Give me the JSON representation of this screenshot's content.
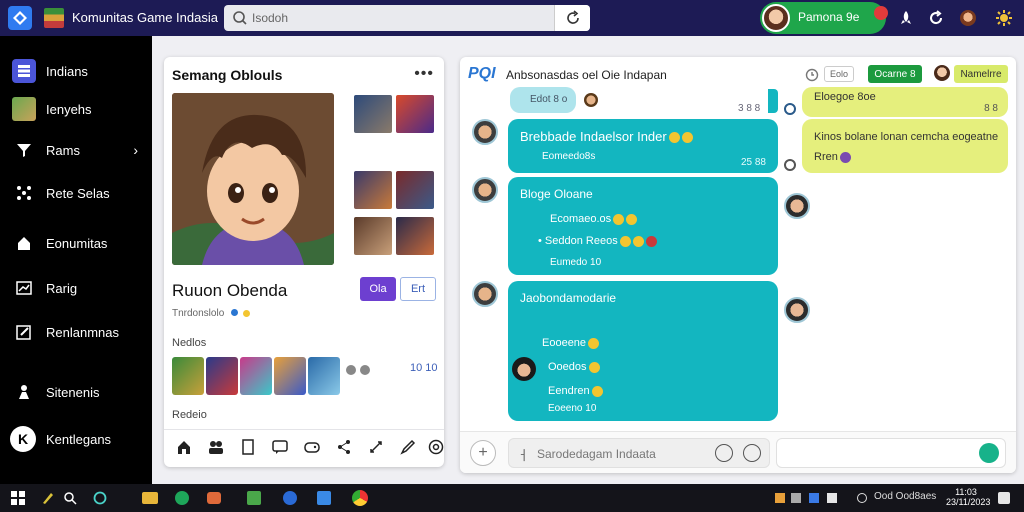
{
  "header": {
    "app_title": "Komunitas Game Indasia",
    "search_placeholder": "Isodoh",
    "user_name": "Pamona 9e",
    "icons": [
      "app-logo-icon",
      "flag-icon",
      "search-icon",
      "refresh-icon",
      "notification-icon",
      "rocket-icon",
      "refresh-circle-icon",
      "avatar-icon",
      "settings-icon"
    ]
  },
  "sidebar": {
    "items": [
      {
        "label": "Indians",
        "icon": "grid-icon"
      },
      {
        "label": "Ienyehs",
        "icon": "image-icon"
      },
      {
        "label": "Rams",
        "icon": "filter-icon",
        "has_chevron": true
      },
      {
        "label": "Rete Selas",
        "icon": "network-icon"
      },
      {
        "label": "Eonumitas",
        "icon": "home-icon"
      },
      {
        "label": "Rarig",
        "icon": "chart-icon"
      },
      {
        "label": "Renlanmnas",
        "icon": "edit-icon"
      },
      {
        "label": "Sitenenis",
        "icon": "person-icon"
      },
      {
        "label": "Kentlegans",
        "icon": "k-badge-icon"
      }
    ],
    "chevron": "›"
  },
  "profile": {
    "title": "Semang Oblouls",
    "more": "•••",
    "name": "Ruuon Obenda",
    "button_primary": "Ola",
    "button_secondary": "Ert",
    "status": "Tnrdonslolo",
    "section_games": "Nedlos",
    "games_count": "10 10",
    "section_recent": "Redeio"
  },
  "chat": {
    "logo": "PQI",
    "title": "Anbsonasdas oel Oie Indapan",
    "header_buttons": {
      "gray": "Eolo",
      "green": "Ocarne 8",
      "lime": "Namelrre"
    },
    "messages": [
      {
        "side": "top",
        "text": "Edot 8 o",
        "time": "3 8 8"
      },
      {
        "side": "left",
        "text": "Brebbade Indaelsor Inder",
        "sub": "Eomeedo8s",
        "time": "25 88"
      },
      {
        "side": "left",
        "text": "Bloge Oloane",
        "line2": "Ecomaeo.os",
        "line3": "Seddon Reeos",
        "time": "Eumedo 10"
      },
      {
        "side": "left",
        "text": "Jaobondamodarie",
        "line2": "Eooeene",
        "line3": "Ooedos",
        "line4": "Eendren",
        "time": "Eoeeno 10"
      }
    ],
    "yellow_messages": [
      {
        "text": "Eloegoe 8oe",
        "time": "8 8"
      },
      {
        "text": "Kinos bolane lonan cemcha eogeatne",
        "line2": "Rren"
      }
    ],
    "composer_placeholder": "Sarodedagam Indaata"
  },
  "taskbar": {
    "right_label": "Ood Ood8aes",
    "clock_time": "11:03",
    "clock_date": "23/11/2023"
  }
}
